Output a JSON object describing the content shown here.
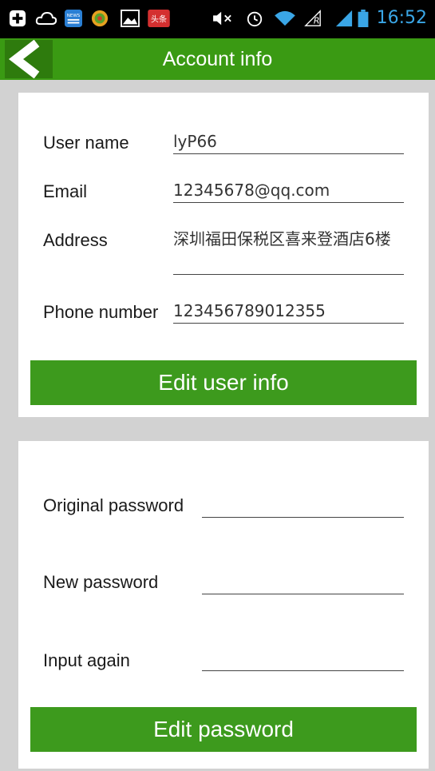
{
  "status_bar": {
    "time": "16:52",
    "icons": [
      "plus-icon",
      "cloud-icon",
      "news-app-icon",
      "gamepad-app-icon",
      "gallery-icon",
      "toutiao-app-icon",
      "mute-icon",
      "alarm-icon",
      "wifi-icon",
      "signal-r-icon",
      "cell-signal-icon",
      "battery-icon"
    ],
    "news_label": "NEWS",
    "toutiao_label": "头条"
  },
  "header": {
    "title": "Account info"
  },
  "account": {
    "username_label": "User name",
    "username_value": "lyP66",
    "email_label": "Email",
    "email_value": "12345678@qq.com",
    "address_label": "Address",
    "address_value": "深圳福田保税区喜来登酒店6楼",
    "phone_label": "Phone number",
    "phone_value": "123456789012355",
    "edit_button": "Edit user info"
  },
  "password": {
    "original_label": "Original password",
    "new_label": "New password",
    "again_label": "Input again",
    "edit_button": "Edit password"
  },
  "colors": {
    "accent_green": "#3a9a13",
    "button_green": "#3d9a1d",
    "status_blue": "#3aa6e6"
  }
}
